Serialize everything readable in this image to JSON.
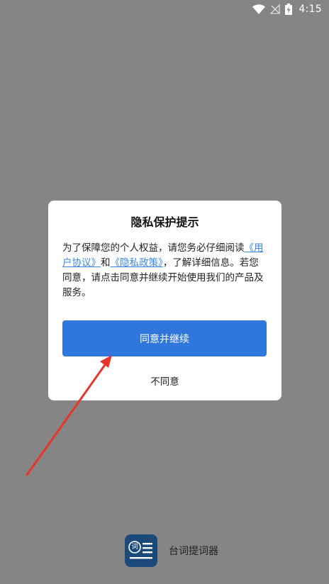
{
  "status_bar": {
    "time": "4:15",
    "icons": [
      "wifi-icon",
      "no-signal-icon",
      "battery-charging-icon"
    ]
  },
  "dialog": {
    "title": "隐私保护提示",
    "body_prefix": "为了保障您的个人权益，请您务必仔细阅读",
    "user_agreement_link": "《用户协议》",
    "and_text": "和",
    "privacy_policy_link": "《隐私政策》",
    "body_suffix": "，了解详细信息。若您同意，请点击同意并继续开始使用我们的产品及服务。",
    "agree_label": "同意并继续",
    "disagree_label": "不同意"
  },
  "app": {
    "logo_glyph": "词",
    "name": "台词提词器"
  },
  "colors": {
    "overlay": "#858585",
    "primary_button": "#2f77dc",
    "link": "#3a86e0",
    "arrow": "#e8352b",
    "logo_bg": "#1b4a7a"
  }
}
